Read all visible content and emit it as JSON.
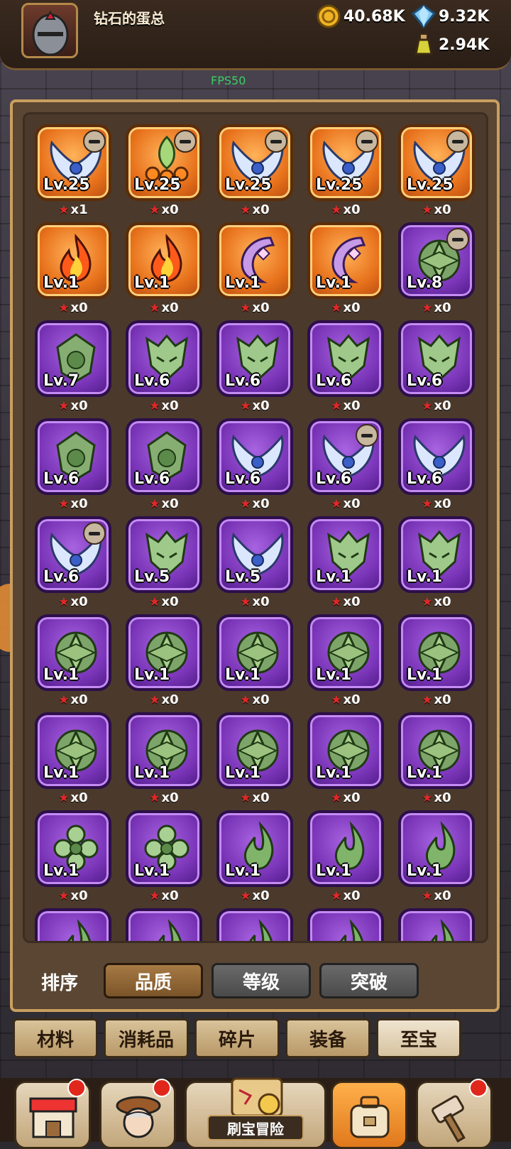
{
  "header": {
    "player_name": "钻石的蛋总",
    "gold": "40.68K",
    "diamond": "9.32K",
    "potion": "2.94K",
    "fps": "FPS50"
  },
  "items": [
    {
      "rarity": "orange",
      "level": "Lv.25",
      "stars": "x1",
      "hero": true,
      "art": "wings"
    },
    {
      "rarity": "orange",
      "level": "Lv.25",
      "stars": "x0",
      "hero": true,
      "art": "leaf"
    },
    {
      "rarity": "orange",
      "level": "Lv.25",
      "stars": "x0",
      "hero": true,
      "art": "wings"
    },
    {
      "rarity": "orange",
      "level": "Lv.25",
      "stars": "x0",
      "hero": true,
      "art": "wings"
    },
    {
      "rarity": "orange",
      "level": "Lv.25",
      "stars": "x0",
      "hero": true,
      "art": "wings"
    },
    {
      "rarity": "orange",
      "level": "Lv.1",
      "stars": "x0",
      "hero": false,
      "art": "flame"
    },
    {
      "rarity": "orange",
      "level": "Lv.1",
      "stars": "x0",
      "hero": false,
      "art": "flame"
    },
    {
      "rarity": "orange",
      "level": "Lv.1",
      "stars": "x0",
      "hero": false,
      "art": "moon"
    },
    {
      "rarity": "orange",
      "level": "Lv.1",
      "stars": "x0",
      "hero": false,
      "art": "moon"
    },
    {
      "rarity": "purple",
      "level": "Lv.8",
      "stars": "x0",
      "hero": true,
      "art": "rune"
    },
    {
      "rarity": "purple",
      "level": "Lv.7",
      "stars": "x0",
      "hero": false,
      "art": "shield"
    },
    {
      "rarity": "purple",
      "level": "Lv.6",
      "stars": "x0",
      "hero": false,
      "art": "mask"
    },
    {
      "rarity": "purple",
      "level": "Lv.6",
      "stars": "x0",
      "hero": false,
      "art": "mask"
    },
    {
      "rarity": "purple",
      "level": "Lv.6",
      "stars": "x0",
      "hero": false,
      "art": "mask"
    },
    {
      "rarity": "purple",
      "level": "Lv.6",
      "stars": "x0",
      "hero": false,
      "art": "mask"
    },
    {
      "rarity": "purple",
      "level": "Lv.6",
      "stars": "x0",
      "hero": false,
      "art": "shield"
    },
    {
      "rarity": "purple",
      "level": "Lv.6",
      "stars": "x0",
      "hero": false,
      "art": "shield"
    },
    {
      "rarity": "purple",
      "level": "Lv.6",
      "stars": "x0",
      "hero": false,
      "art": "wings"
    },
    {
      "rarity": "purple",
      "level": "Lv.6",
      "stars": "x0",
      "hero": true,
      "art": "wings"
    },
    {
      "rarity": "purple",
      "level": "Lv.6",
      "stars": "x0",
      "hero": false,
      "art": "wings"
    },
    {
      "rarity": "purple",
      "level": "Lv.6",
      "stars": "x0",
      "hero": true,
      "art": "wings"
    },
    {
      "rarity": "purple",
      "level": "Lv.5",
      "stars": "x0",
      "hero": false,
      "art": "mask"
    },
    {
      "rarity": "purple",
      "level": "Lv.5",
      "stars": "x0",
      "hero": false,
      "art": "wings"
    },
    {
      "rarity": "purple",
      "level": "Lv.1",
      "stars": "x0",
      "hero": false,
      "art": "mask"
    },
    {
      "rarity": "purple",
      "level": "Lv.1",
      "stars": "x0",
      "hero": false,
      "art": "mask"
    },
    {
      "rarity": "purple",
      "level": "Lv.1",
      "stars": "x0",
      "hero": false,
      "art": "rune"
    },
    {
      "rarity": "purple",
      "level": "Lv.1",
      "stars": "x0",
      "hero": false,
      "art": "rune"
    },
    {
      "rarity": "purple",
      "level": "Lv.1",
      "stars": "x0",
      "hero": false,
      "art": "rune"
    },
    {
      "rarity": "purple",
      "level": "Lv.1",
      "stars": "x0",
      "hero": false,
      "art": "rune"
    },
    {
      "rarity": "purple",
      "level": "Lv.1",
      "stars": "x0",
      "hero": false,
      "art": "rune"
    },
    {
      "rarity": "purple",
      "level": "Lv.1",
      "stars": "x0",
      "hero": false,
      "art": "rune"
    },
    {
      "rarity": "purple",
      "level": "Lv.1",
      "stars": "x0",
      "hero": false,
      "art": "rune"
    },
    {
      "rarity": "purple",
      "level": "Lv.1",
      "stars": "x0",
      "hero": false,
      "art": "rune"
    },
    {
      "rarity": "purple",
      "level": "Lv.1",
      "stars": "x0",
      "hero": false,
      "art": "rune"
    },
    {
      "rarity": "purple",
      "level": "Lv.1",
      "stars": "x0",
      "hero": false,
      "art": "rune"
    },
    {
      "rarity": "purple",
      "level": "Lv.1",
      "stars": "x0",
      "hero": false,
      "art": "flower"
    },
    {
      "rarity": "purple",
      "level": "Lv.1",
      "stars": "x0",
      "hero": false,
      "art": "flower"
    },
    {
      "rarity": "purple",
      "level": "Lv.1",
      "stars": "x0",
      "hero": false,
      "art": "leafflame"
    },
    {
      "rarity": "purple",
      "level": "Lv.1",
      "stars": "x0",
      "hero": false,
      "art": "leafflame"
    },
    {
      "rarity": "purple",
      "level": "Lv.1",
      "stars": "x0",
      "hero": false,
      "art": "leafflame"
    },
    {
      "rarity": "purple",
      "level": "",
      "stars": "",
      "hero": false,
      "art": "leafflame"
    },
    {
      "rarity": "purple",
      "level": "",
      "stars": "",
      "hero": false,
      "art": "leafflame"
    },
    {
      "rarity": "purple",
      "level": "",
      "stars": "",
      "hero": false,
      "art": "leafflame"
    },
    {
      "rarity": "purple",
      "level": "",
      "stars": "",
      "hero": false,
      "art": "leafflame"
    },
    {
      "rarity": "purple",
      "level": "",
      "stars": "",
      "hero": false,
      "art": "leafflame"
    }
  ],
  "sort": {
    "label": "排序",
    "options": [
      "品质",
      "等级",
      "突破"
    ],
    "selected": 0
  },
  "categories": {
    "tabs": [
      "材料",
      "消耗品",
      "碎片",
      "装备",
      "至宝"
    ],
    "selected": 4
  },
  "nav": {
    "adventure_label": "刷宝冒险"
  }
}
